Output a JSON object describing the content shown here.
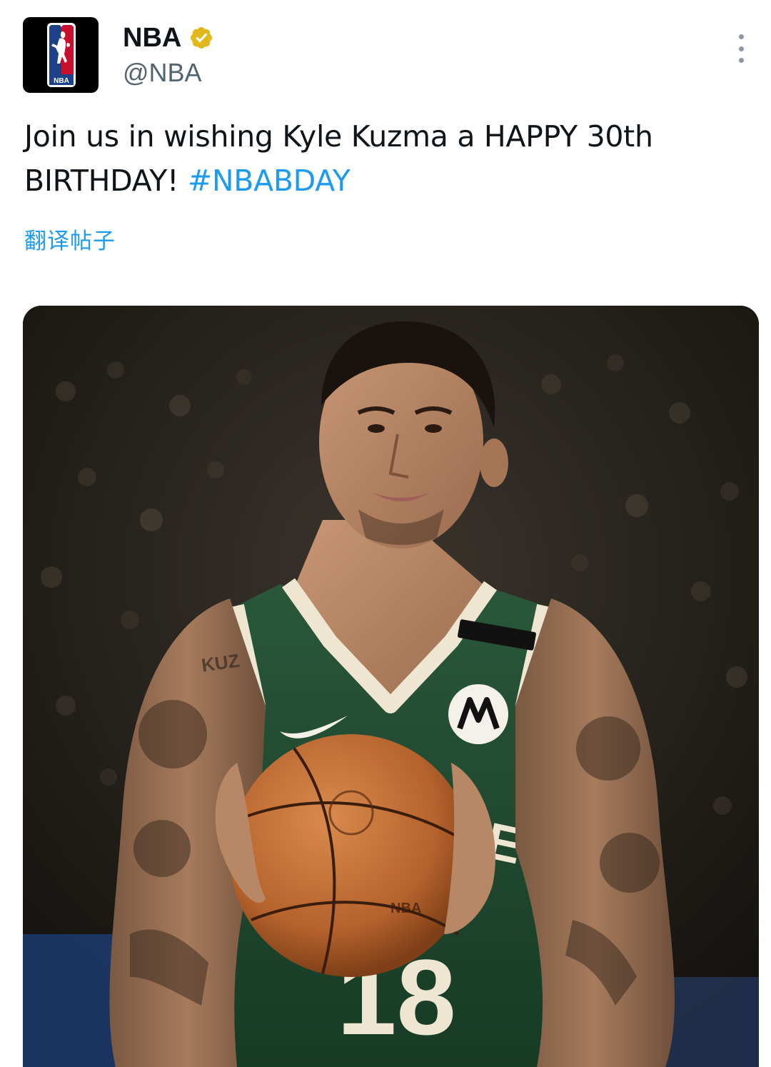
{
  "tweet": {
    "author": {
      "display_name": "NBA",
      "handle": "@NBA",
      "verified": true,
      "verified_color": "#e2b719",
      "avatar_logo": "nba-logo",
      "avatar_logo_text": "NBA"
    },
    "text_plain": "Join us in wishing Kyle Kuzma a HAPPY 30th BIRTHDAY! ",
    "hashtag": "#NBABDAY",
    "translate_label": "翻译帖子",
    "media": {
      "type": "photo",
      "jersey_number": "18",
      "jersey_letters": "KEE",
      "ball_lettering": "NBA",
      "tattoo_text": "KUZ"
    }
  },
  "colors": {
    "link": "#1d9bf0",
    "text": "#0f1419",
    "secondary": "#536471",
    "jersey_green": "#1f4a2f",
    "jersey_cream": "#efe6d2",
    "ball_orange": "#c46a32"
  },
  "icons": {
    "more": "more-vertical-icon",
    "verified": "verified-badge-icon"
  }
}
